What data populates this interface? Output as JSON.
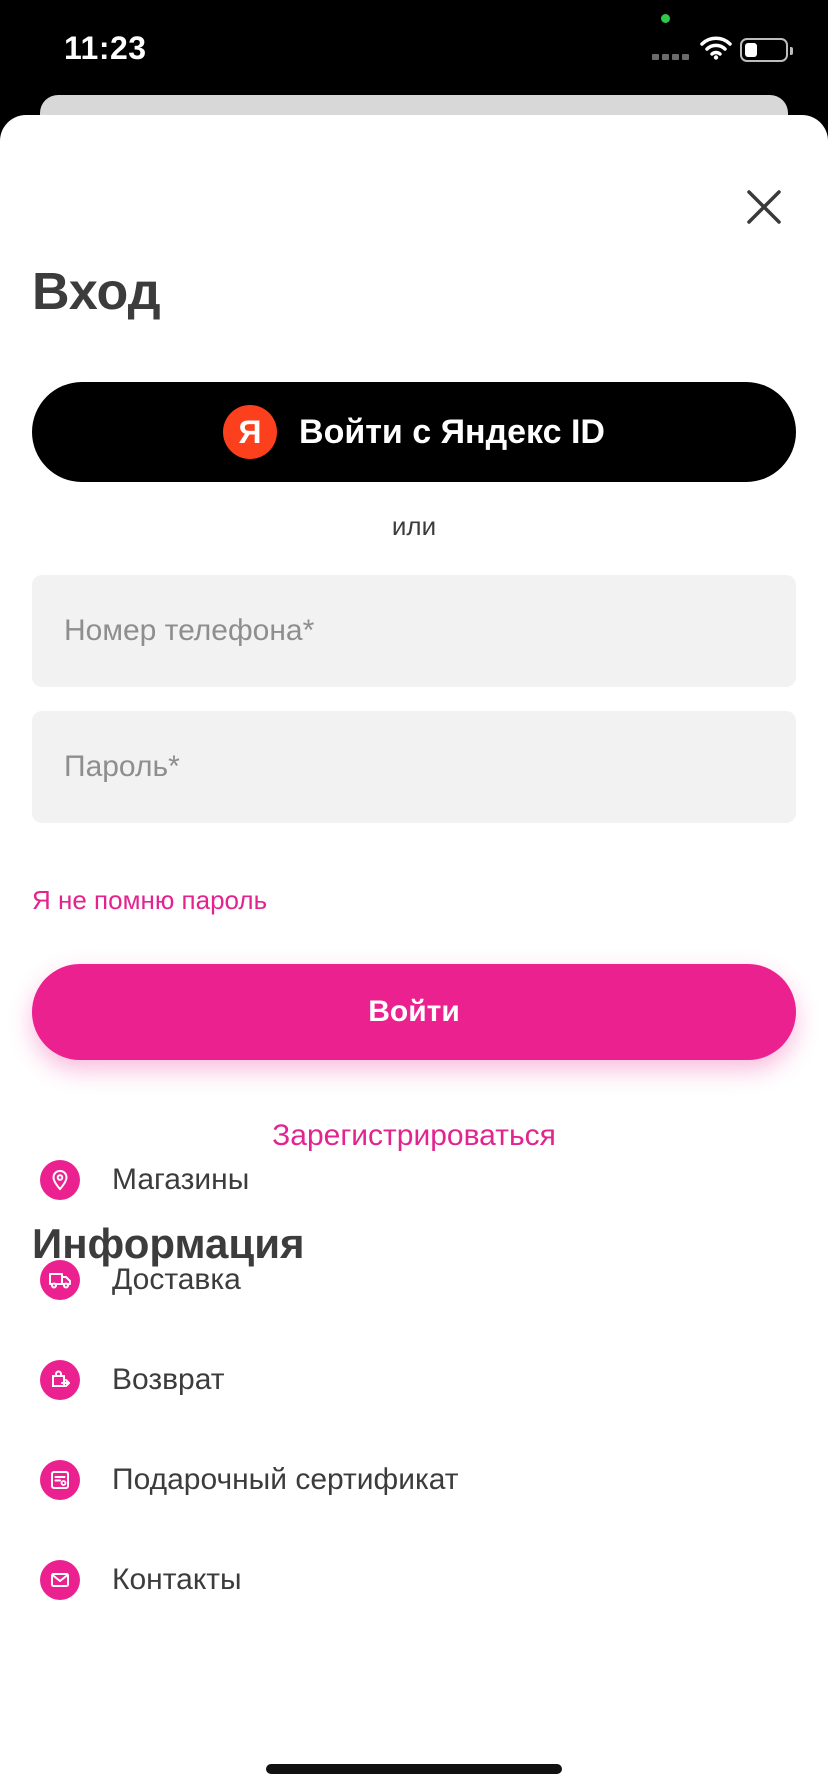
{
  "status_bar": {
    "time": "11:23"
  },
  "login": {
    "title": "Вход",
    "yandex_logo_letter": "Я",
    "yandex_button_label": "Войти с Яндекс ID",
    "or_text": "или",
    "phone_placeholder": "Номер телефона*",
    "password_placeholder": "Пароль*",
    "forgot_password": "Я не помню пароль",
    "login_button": "Войти",
    "register_link": "Зарегистрироваться"
  },
  "info": {
    "title": "Информация",
    "items": [
      {
        "label": "Магазины",
        "icon": "location-pin-icon"
      },
      {
        "label": "Доставка",
        "icon": "truck-icon"
      },
      {
        "label": "Возврат",
        "icon": "return-bag-icon"
      },
      {
        "label": "Подарочный сертификат",
        "icon": "gift-certificate-icon"
      },
      {
        "label": "Контакты",
        "icon": "mail-icon"
      }
    ]
  },
  "colors": {
    "accent": "#ec2190",
    "yandex_red": "#fc3f1d",
    "text_dark": "#3c3c3c",
    "field_bg": "#f2f2f2"
  }
}
